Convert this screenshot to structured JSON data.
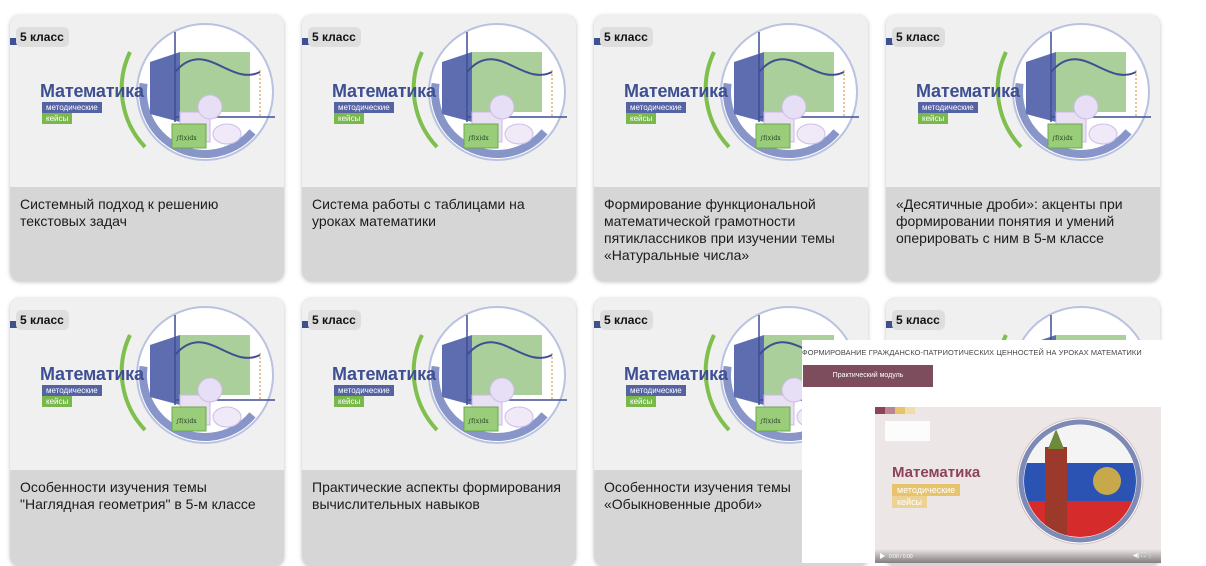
{
  "cards": [
    {
      "badge": "5 класс",
      "logo_title": "Математика",
      "logo_sub1": "методические",
      "logo_sub2": "кейсы",
      "formula": "∫f(x)dx",
      "title": "Системный подход к решению текстовых задач"
    },
    {
      "badge": "5 класс",
      "logo_title": "Математика",
      "logo_sub1": "методические",
      "logo_sub2": "кейсы",
      "formula": "∫f(x)dx",
      "title": "Система работы с таблицами на уроках математики"
    },
    {
      "badge": "5 класс",
      "logo_title": "Математика",
      "logo_sub1": "методические",
      "logo_sub2": "кейсы",
      "formula": "∫f(x)dx",
      "title": "Формирование функциональной математической грамотности пятиклассников при изучении темы «Натуральные числа»"
    },
    {
      "badge": "5 класс",
      "logo_title": "Математика",
      "logo_sub1": "методические",
      "logo_sub2": "кейсы",
      "formula": "∫f(x)dx",
      "title": "«Десятичные дроби»: акценты при формировании понятия и умений оперировать с ним в 5-м классе"
    },
    {
      "badge": "5 класс",
      "logo_title": "Математика",
      "logo_sub1": "методические",
      "logo_sub2": "кейсы",
      "formula": "∫f(x)dx",
      "title": "Особенности изучения темы \"Наглядная геометрия\" в 5-м классе"
    },
    {
      "badge": "5 класс",
      "logo_title": "Математика",
      "logo_sub1": "методические",
      "logo_sub2": "кейсы",
      "formula": "∫f(x)dx",
      "title": "Практические аспекты формирования вычислительных навыков"
    },
    {
      "badge": "5 класс",
      "logo_title": "Математика",
      "logo_sub1": "методические",
      "logo_sub2": "кейсы",
      "formula": "∫f(x)dx",
      "title": "Особенности изучения темы «Обыкновенные дроби»"
    },
    {
      "badge": "5 класс",
      "logo_title": "",
      "logo_sub1": "",
      "logo_sub2": "",
      "formula": "",
      "title": ""
    }
  ],
  "popup": {
    "title": "ФОРМИРОВАНИЕ ГРАЖДАНСКО-ПАТРИОТИЧЕСКИХ ЦЕННОСТЕЙ НА УРОКАХ МАТЕМАТИКИ",
    "button": "Практический модуль",
    "video": {
      "title": "Математика",
      "sub1": "методические",
      "sub2": "кейсы",
      "time": "0:00 / 0:00",
      "controls": "◀)  ⛶  ⋮"
    }
  },
  "colors": {
    "brand_blue": "#3e4f92",
    "brand_green": "#79b84b",
    "card_bg": "#d6d6d6",
    "popup_accent": "#7e4d5d"
  },
  "icons": [
    "badge-stripe",
    "graph-illustration",
    "play-icon",
    "volume-icon",
    "fullscreen-icon",
    "more-icon"
  ]
}
